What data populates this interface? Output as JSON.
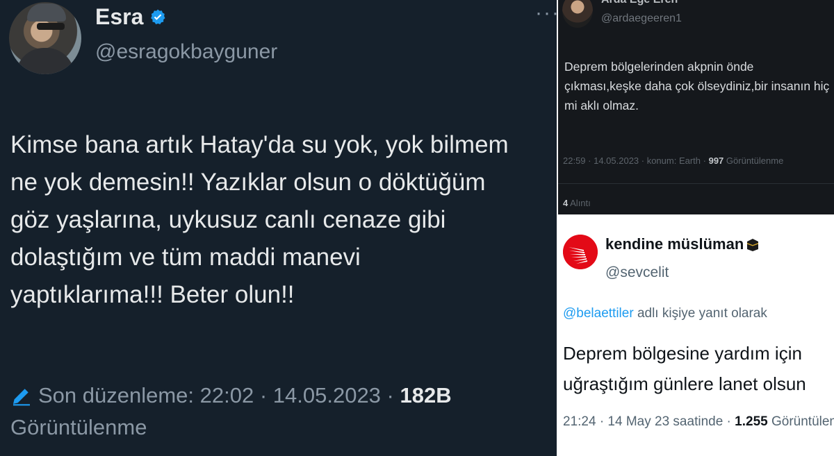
{
  "left_tweet": {
    "name": "Esra",
    "handle": "@esragokbayguner",
    "menu": "···",
    "text": "Kimse bana artık Hatay'da su yok, yok bilmem\nne yok demesin!! Yazıklar olsun o döktüğüm\ngöz yaşlarına, uykusuz canlı cenaze gibi\ndolaştığım ve tüm maddi manevi\nyaptıklarıma!!! Beter olun!!",
    "edit_info": "Son düzenleme: 22:02 · 14.05.2023 ·",
    "views_count": "182B",
    "views_label": "Görüntülenme",
    "accent": "#1d9bf0"
  },
  "right_top_tweet": {
    "name": "Arda Ege Eren",
    "handle": "@ardaegeeren1",
    "text": "Deprem bölgelerinden akpnin önde\nçıkması,keşke daha çok ölseydiniz,bir insanın hiç\nmi aklı olmaz.",
    "meta": "22:59 · 14.05.2023 · konum: Earth ·",
    "views_count": "997",
    "views_label": "Görüntülenme",
    "quotes_count": "4",
    "quotes_label": "Alıntı"
  },
  "right_bottom_tweet": {
    "name": "kendine müslüman",
    "handle": "@sevcelit",
    "reply_mention": "@belaettiler",
    "reply_suffix": "adlı kişiye yanıt olarak",
    "text": "Deprem bölgesine yardım için\nuğraştığım günlere lanet olsun",
    "meta": "21:24 · 14 May 23 saatinde ·",
    "views_count": "1.255",
    "views_label": "Görüntülenme"
  },
  "icons": [
    "verified-badge-icon",
    "edit-pencil-icon",
    "more-icon",
    "kaaba-emoji-icon",
    "party-logo-icon"
  ]
}
